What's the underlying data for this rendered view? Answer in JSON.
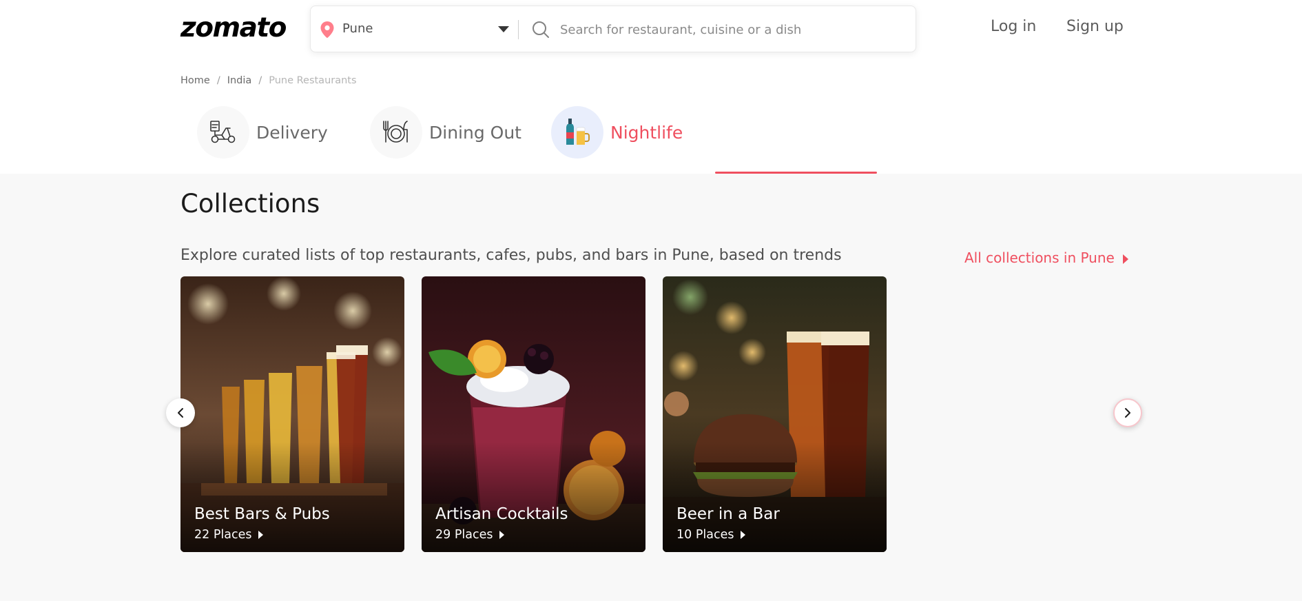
{
  "header": {
    "logo": "zomato",
    "location": "Pune",
    "search_placeholder": "Search for restaurant, cuisine or a dish",
    "login": "Log in",
    "signup": "Sign up"
  },
  "breadcrumb": [
    "Home",
    "India",
    "Pune Restaurants"
  ],
  "tabs": [
    {
      "label": "Delivery",
      "icon": "scooter-icon",
      "active": false
    },
    {
      "label": "Dining Out",
      "icon": "plate-cutlery-icon",
      "active": false
    },
    {
      "label": "Nightlife",
      "icon": "bottle-beer-icon",
      "active": true
    }
  ],
  "collections": {
    "title": "Collections",
    "description": "Explore curated lists of top restaurants, cafes, pubs, and bars in Pune, based on trends",
    "all_link": "All collections in Pune",
    "cards": [
      {
        "title": "Best Bars & Pubs",
        "count": "22 Places"
      },
      {
        "title": "Artisan Cocktails",
        "count": "29 Places"
      },
      {
        "title": "Beer in a Bar",
        "count": "10 Places"
      }
    ]
  },
  "colors": {
    "accent": "#ef4f5f",
    "section_bg": "#f8f8f8"
  }
}
